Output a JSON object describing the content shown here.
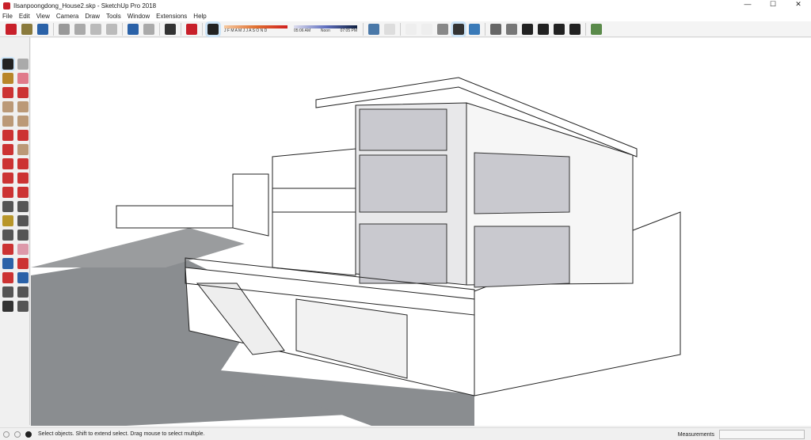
{
  "window": {
    "title": "Ilsanpoongdong_House2.skp - SketchUp Pro 2018",
    "controls": [
      "—",
      "☐",
      "✕"
    ]
  },
  "menu": [
    "File",
    "Edit",
    "View",
    "Camera",
    "Draw",
    "Tools",
    "Window",
    "Extensions",
    "Help"
  ],
  "toolbar": {
    "icons": [
      {
        "name": "new-icon",
        "color": "#c8202a"
      },
      {
        "name": "open-icon",
        "color": "#8a7a3c"
      },
      {
        "name": "save-icon",
        "color": "#2b62a8"
      },
      null,
      {
        "name": "cut-icon",
        "color": "#999"
      },
      {
        "name": "copy-icon",
        "color": "#aaa"
      },
      {
        "name": "paste-icon",
        "color": "#bbb"
      },
      {
        "name": "erase-icon",
        "color": "#bbb"
      },
      null,
      {
        "name": "undo-icon",
        "color": "#2b62a8"
      },
      {
        "name": "redo-icon",
        "color": "#aaa"
      },
      null,
      {
        "name": "print-icon",
        "color": "#333"
      },
      null,
      {
        "name": "model-info-icon",
        "color": "#c8202a"
      },
      null,
      {
        "name": "shadows-toggle-icon",
        "color": "#222",
        "active": true
      }
    ],
    "shadow": {
      "months": "J F M A M J J A S O N D",
      "time_start": "05:06 AM",
      "time_mid": "Noon",
      "time_end": "07:05 PM"
    },
    "icons2": [
      {
        "name": "xray-icon",
        "color": "#4a78a8"
      },
      {
        "name": "back-edges-icon",
        "color": "#ddd"
      },
      null,
      {
        "name": "wireframe-icon",
        "color": "#eee"
      },
      {
        "name": "hidden-line-icon",
        "color": "#eee"
      },
      {
        "name": "shaded-icon",
        "color": "#888"
      },
      {
        "name": "shaded-textures-icon",
        "color": "#333",
        "active": true
      },
      {
        "name": "monochrome-icon",
        "color": "#3a7ab8"
      },
      null,
      {
        "name": "iso-view-icon",
        "color": "#666"
      },
      {
        "name": "top-view-icon",
        "color": "#777"
      },
      {
        "name": "front-view-icon",
        "color": "#222"
      },
      {
        "name": "right-view-icon",
        "color": "#222"
      },
      {
        "name": "back-view-icon",
        "color": "#222"
      },
      {
        "name": "left-view-icon",
        "color": "#222"
      },
      null,
      {
        "name": "warehouse-icon",
        "color": "#5a8a4a"
      }
    ]
  },
  "left_tools": [
    {
      "name": "select-tool-icon",
      "color": "#222"
    },
    {
      "name": "make-component-icon",
      "color": "#aaa"
    },
    {
      "name": "paint-bucket-icon",
      "color": "#b8862a"
    },
    {
      "name": "eraser-icon",
      "color": "#e07a8a"
    },
    {
      "name": "line-icon",
      "color": "#c33"
    },
    {
      "name": "freehand-icon",
      "color": "#c33"
    },
    {
      "name": "rectangle-icon",
      "color": "#b97"
    },
    {
      "name": "rotated-rectangle-icon",
      "color": "#b97"
    },
    {
      "name": "circle-icon",
      "color": "#b97"
    },
    {
      "name": "polygon-icon",
      "color": "#b97"
    },
    {
      "name": "arc-icon",
      "color": "#c33"
    },
    {
      "name": "two-point-arc-icon",
      "color": "#c33"
    },
    {
      "name": "three-point-arc-icon",
      "color": "#c33"
    },
    {
      "name": "pie-icon",
      "color": "#b97"
    },
    {
      "name": "move-icon",
      "color": "#c33"
    },
    {
      "name": "push-pull-icon",
      "color": "#c33"
    },
    {
      "name": "rotate-icon",
      "color": "#c33"
    },
    {
      "name": "follow-me-icon",
      "color": "#c33"
    },
    {
      "name": "scale-icon",
      "color": "#c33"
    },
    {
      "name": "offset-icon",
      "color": "#c33"
    },
    {
      "name": "tape-measure-icon",
      "color": "#555"
    },
    {
      "name": "dimension-icon",
      "color": "#555"
    },
    {
      "name": "protractor-icon",
      "color": "#b8962a"
    },
    {
      "name": "text-icon",
      "color": "#555"
    },
    {
      "name": "axes-icon",
      "color": "#555"
    },
    {
      "name": "3d-text-icon",
      "color": "#555"
    },
    {
      "name": "orbit-icon",
      "color": "#c33"
    },
    {
      "name": "pan-icon",
      "color": "#d9a"
    },
    {
      "name": "zoom-icon",
      "color": "#2b62a8"
    },
    {
      "name": "zoom-window-icon",
      "color": "#c33"
    },
    {
      "name": "zoom-extents-icon",
      "color": "#c33"
    },
    {
      "name": "previous-icon",
      "color": "#2b62a8"
    },
    {
      "name": "position-camera-icon",
      "color": "#555"
    },
    {
      "name": "look-around-icon",
      "color": "#555"
    },
    {
      "name": "walk-icon",
      "color": "#333"
    },
    {
      "name": "section-plane-icon",
      "color": "#555"
    }
  ],
  "status": {
    "message": "Select objects. Shift to extend select. Drag mouse to select multiple.",
    "measurements_label": "Measurements",
    "measurements_value": ""
  }
}
